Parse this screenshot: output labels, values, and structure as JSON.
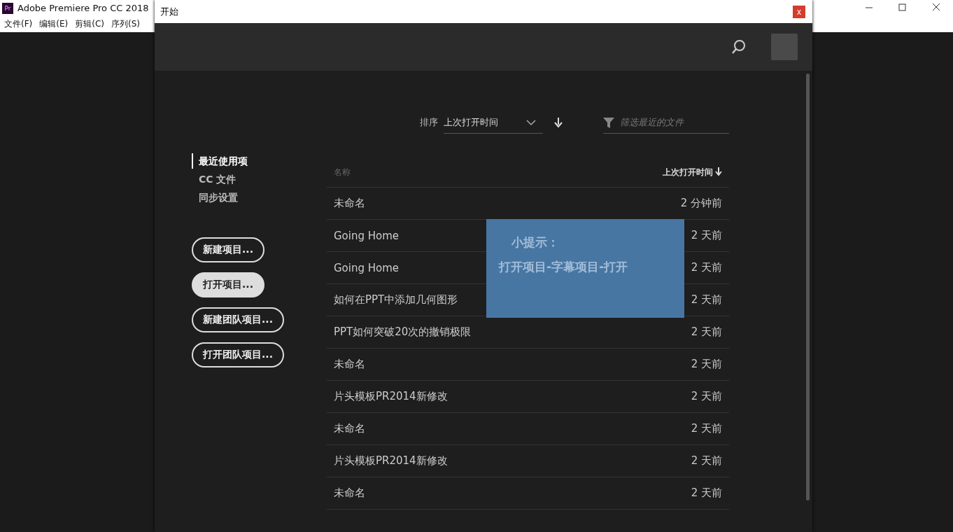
{
  "app": {
    "icon": "Pr",
    "title": "Adobe Premiere Pro CC 2018",
    "menu": [
      "文件(F)",
      "编辑(E)",
      "剪辑(C)",
      "序列(S)"
    ]
  },
  "dialog": {
    "title": "开始",
    "close": "x"
  },
  "sort": {
    "label": "排序",
    "value": "上次打开时间",
    "filter_placeholder": "筛选最近的文件"
  },
  "nav": [
    {
      "label": "最近使用项",
      "selected": true
    },
    {
      "label": "CC 文件",
      "selected": false
    },
    {
      "label": "同步设置",
      "selected": false
    }
  ],
  "buttons": [
    {
      "label": "新建项目...",
      "hovered": false
    },
    {
      "label": "打开项目...",
      "hovered": true
    },
    {
      "label": "新建团队项目...",
      "hovered": false
    },
    {
      "label": "打开团队项目...",
      "hovered": false
    }
  ],
  "table": {
    "columns": [
      "名称",
      "上次打开时间"
    ],
    "rows": [
      {
        "name": "未命名",
        "time": "2 分钟前"
      },
      {
        "name": "Going Home",
        "time": "2 天前"
      },
      {
        "name": "Going Home",
        "time": "2 天前"
      },
      {
        "name": "如何在PPT中添加几何图形",
        "time": "2 天前"
      },
      {
        "name": "PPT如何突破20次的撤销极限",
        "time": "2 天前"
      },
      {
        "name": "未命名",
        "time": "2 天前"
      },
      {
        "name": "片头模板PR2014新修改",
        "time": "2 天前"
      },
      {
        "name": "未命名",
        "time": "2 天前"
      },
      {
        "name": "片头模板PR2014新修改",
        "time": "2 天前"
      },
      {
        "name": "未命名",
        "time": "2 天前"
      }
    ]
  },
  "tip": {
    "title": "小提示：",
    "text": "打开项目-字幕项目-打开"
  }
}
